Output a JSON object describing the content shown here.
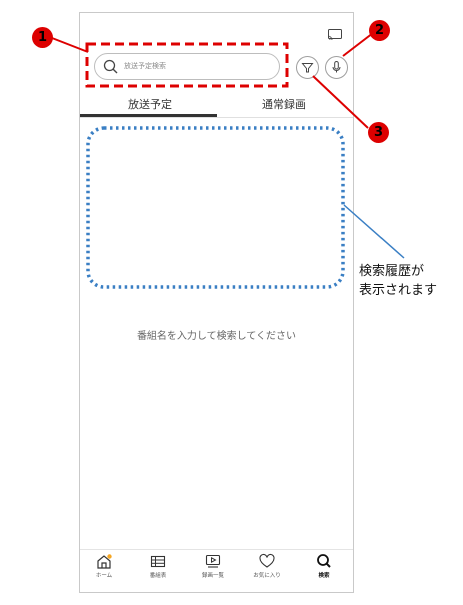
{
  "search": {
    "placeholder": "放送予定検索"
  },
  "tabs": [
    {
      "label": "放送予定",
      "selected": true
    },
    {
      "label": "通常録画",
      "selected": false
    }
  ],
  "empty_message": "番組名を入力して検索してください",
  "bottom_nav": [
    {
      "label": "ホーム",
      "icon": "home-icon"
    },
    {
      "label": "番組表",
      "icon": "program-guide-icon"
    },
    {
      "label": "録画一覧",
      "icon": "recordings-icon"
    },
    {
      "label": "お気に入り",
      "icon": "heart-icon"
    },
    {
      "label": "検索",
      "icon": "search-icon",
      "selected": true
    }
  ],
  "annotations": {
    "callout_1": "1",
    "callout_2": "2",
    "callout_3": "3",
    "history_note_line1": "検索履歴が",
    "history_note_line2": "表示されます"
  },
  "colors": {
    "callout_red": "#dd0000",
    "history_blue": "#3a7fc4",
    "accent_orange": "#f5a623"
  }
}
